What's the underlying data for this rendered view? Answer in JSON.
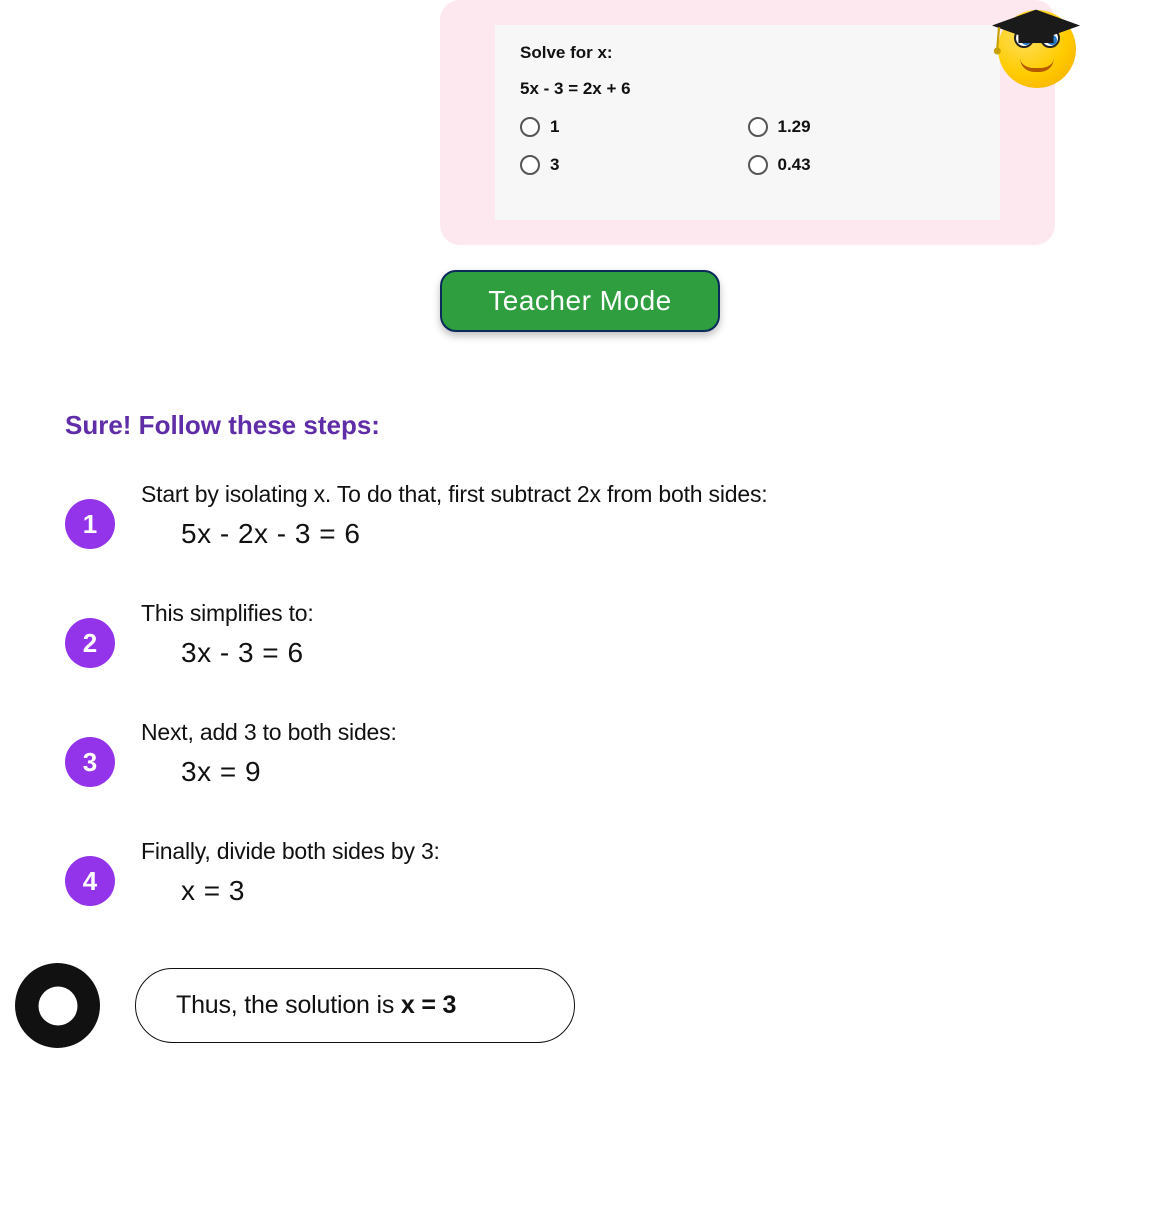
{
  "question": {
    "prompt": "Solve for x:",
    "equation": "5x - 3 = 2x + 6",
    "options": [
      {
        "label": "1"
      },
      {
        "label": "1.29"
      },
      {
        "label": "3"
      },
      {
        "label": "0.43"
      }
    ]
  },
  "teacher_mode_label": "Teacher Mode",
  "steps_intro": "Sure! Follow these steps:",
  "steps": [
    {
      "num": "1",
      "text": "Start by isolating x. To do that, first subtract 2x from both sides:",
      "eq": "5x - 2x - 3 = 6"
    },
    {
      "num": "2",
      "text": "This simplifies to:",
      "eq": "3x - 3 = 6"
    },
    {
      "num": "3",
      "text": "Next, add 3 to both sides:",
      "eq": "3x = 9"
    },
    {
      "num": "4",
      "text": "Finally, divide both sides by 3:",
      "eq": "x = 3"
    }
  ],
  "conclusion": {
    "prefix": "Thus, the solution is ",
    "answer": "x = 3"
  }
}
